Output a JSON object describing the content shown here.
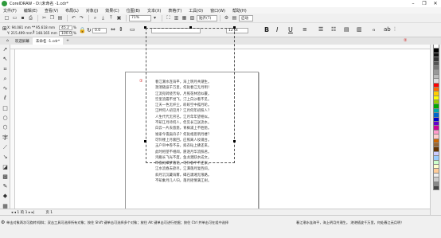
{
  "window": {
    "title": "CorelDRAW - D:\\未命名 -1.cdr*",
    "controls": [
      "–",
      "❐",
      "✕"
    ]
  },
  "menu": [
    "文件(F)",
    "编辑(E)",
    "查看(V)",
    "布局(L)",
    "对象(J)",
    "效果(C)",
    "位图(B)",
    "文本(X)",
    "表格(T)",
    "工具(O)",
    "窗口(W)",
    "帮助(H)"
  ],
  "toolbar": {
    "zoom": "71%",
    "snap": "贴齐(T)",
    "launch": "启动"
  },
  "props": {
    "x": "X: 94.081 mm",
    "y": "Y: 215.499 mm",
    "w": "95.618 mm",
    "h": "148.165 mm",
    "sx": "45.2",
    "sy": "100.0",
    "pct": "%",
    "angle": "0.0",
    "font_size": "12 pt"
  },
  "tabs": [
    "欢迎屏幕",
    "未命名 -1.cdr*"
  ],
  "annotations": {
    "one": "①",
    "two": "②"
  },
  "poem": [
    "春江潮水连海平，海上明月共潮生。",
    "滟滟随波千万里，何处春江无月明！",
    "江流宛转绕芳甸，月照花林皆似霰。",
    "空里流霜不觉飞，汀上白沙看不见。",
    "江天一色无纤尘，皎皎空中孤月轮。",
    "江畔何人初见月？江月何年初照人？",
    "人生代代无穷已，江月年年望相似。",
    "不知江月待何人，但见长江送流水。",
    "白云一片去悠悠，青枫浦上不胜愁。",
    "谁家今夜扁舟子？何处相思明月楼？",
    "可怜楼上月裴回，应照离人妆镜台。",
    "玉户帘中卷不去，捣衣砧上拂还来。",
    "此时相望不相闻，愿逐月华流照君。",
    "鸿雁长飞光不度，鱼龙潜跃水成文。",
    "昨夜闲潭梦落花，可怜春半不还家。",
    "江水流春去欲尽，江潭落月复西斜。",
    "斜月沉沉藏海雾，碣石潇湘无限路。",
    "不知乘月几人归，落月摇情满江树。"
  ],
  "pagebar": {
    "nav": "◂  ◂  1 的 1  ▸  ▸|",
    "page": "页 1"
  },
  "status": {
    "hint": "单击对象两次可旋转/倾斜；双击工具可选择所有对象；按住 Shift 键单击可选择多个对象；按住 Alt 键单击可进行挖掘；按住 Ctrl 并单击可在组中选择",
    "right": "春江潮水连海平，海上明月共潮生。 滟滟随波千万里，何处春江无月明！"
  },
  "palette_colors": [
    "#ffffff",
    "#000000",
    "#111111",
    "#333333",
    "#555555",
    "#777777",
    "#999999",
    "#bbbbbb",
    "#dddddd",
    "#ff0000",
    "#ff6600",
    "#ffcc00",
    "#ffff00",
    "#99cc00",
    "#00aa00",
    "#00aaaa",
    "#0066cc",
    "#0000cc",
    "#6600cc",
    "#cc0099",
    "#ff99cc",
    "#ffcccc",
    "#cc6600",
    "#996633",
    "#663300",
    "#ccccff",
    "#99ccff",
    "#ccffcc",
    "#ffffcc",
    "#ffcc99",
    "#eeeeee",
    "#cccccc",
    "#888888",
    "#444444"
  ]
}
